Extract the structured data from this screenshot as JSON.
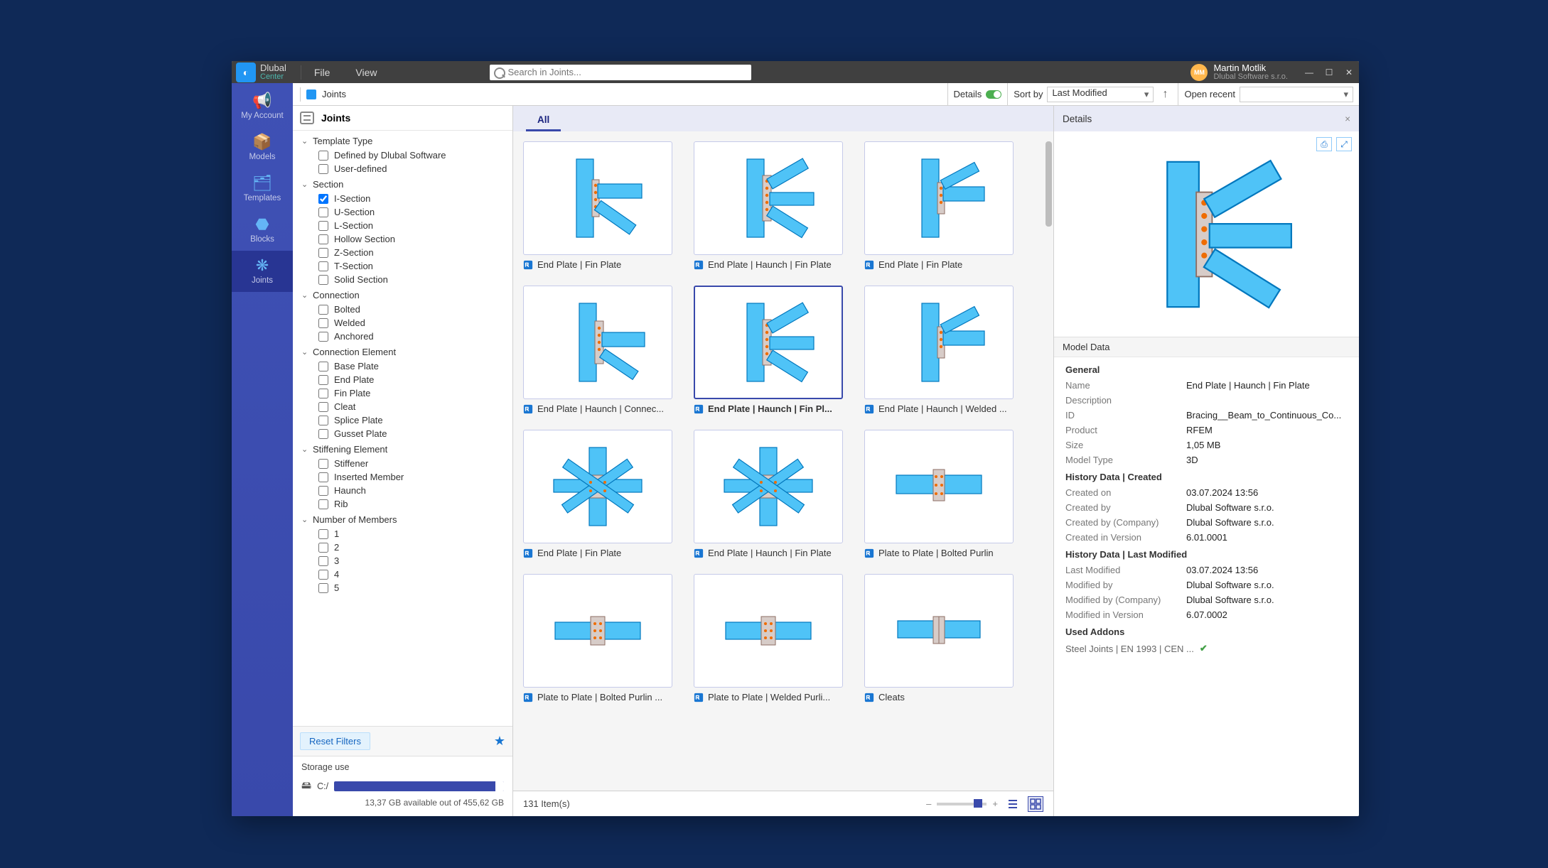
{
  "app": {
    "brand_line1": "Dlubal",
    "brand_line2": "Center"
  },
  "menu": {
    "file": "File",
    "view": "View"
  },
  "search": {
    "placeholder": "Search in Joints..."
  },
  "user": {
    "initials": "MM",
    "name": "Martin Motlik",
    "company": "Dlubal Software s.r.o."
  },
  "navbar": [
    {
      "label": "My Account"
    },
    {
      "label": "Models"
    },
    {
      "label": "Templates"
    },
    {
      "label": "Blocks"
    },
    {
      "label": "Joints"
    }
  ],
  "breadcrumb": {
    "label": "Joints"
  },
  "toolbar": {
    "details_label": "Details",
    "sort_by_label": "Sort by",
    "sort_by_value": "Last Modified",
    "open_recent_label": "Open recent",
    "open_recent_value": ""
  },
  "filter": {
    "title": "Joints",
    "groups": [
      {
        "name": "Template Type",
        "options": [
          {
            "label": "Defined by Dlubal Software",
            "checked": false
          },
          {
            "label": "User-defined",
            "checked": false
          }
        ]
      },
      {
        "name": "Section",
        "options": [
          {
            "label": "I-Section",
            "checked": true
          },
          {
            "label": "U-Section",
            "checked": false
          },
          {
            "label": "L-Section",
            "checked": false
          },
          {
            "label": "Hollow Section",
            "checked": false
          },
          {
            "label": "Z-Section",
            "checked": false
          },
          {
            "label": "T-Section",
            "checked": false
          },
          {
            "label": "Solid Section",
            "checked": false
          }
        ]
      },
      {
        "name": "Connection",
        "options": [
          {
            "label": "Bolted",
            "checked": false
          },
          {
            "label": "Welded",
            "checked": false
          },
          {
            "label": "Anchored",
            "checked": false
          }
        ]
      },
      {
        "name": "Connection Element",
        "options": [
          {
            "label": "Base Plate",
            "checked": false
          },
          {
            "label": "End Plate",
            "checked": false
          },
          {
            "label": "Fin Plate",
            "checked": false
          },
          {
            "label": "Cleat",
            "checked": false
          },
          {
            "label": "Splice Plate",
            "checked": false
          },
          {
            "label": "Gusset Plate",
            "checked": false
          }
        ]
      },
      {
        "name": "Stiffening Element",
        "options": [
          {
            "label": "Stiffener",
            "checked": false
          },
          {
            "label": "Inserted Member",
            "checked": false
          },
          {
            "label": "Haunch",
            "checked": false
          },
          {
            "label": "Rib",
            "checked": false
          }
        ]
      },
      {
        "name": "Number of Members",
        "options": [
          {
            "label": "1",
            "checked": false
          },
          {
            "label": "2",
            "checked": false
          },
          {
            "label": "3",
            "checked": false
          },
          {
            "label": "4",
            "checked": false
          },
          {
            "label": "5",
            "checked": false
          }
        ]
      }
    ],
    "reset_label": "Reset Filters"
  },
  "storage": {
    "title": "Storage use",
    "drive": "C:/",
    "line": "13,37 GB available out of 455,62 GB"
  },
  "tabs": {
    "all": "All"
  },
  "gallery": {
    "items": [
      {
        "title": "End Plate | Fin Plate",
        "shape": "A"
      },
      {
        "title": "End Plate | Haunch | Fin Plate",
        "shape": "B"
      },
      {
        "title": "End Plate | Fin Plate",
        "shape": "C"
      },
      {
        "title": "End Plate | Haunch | Connec...",
        "shape": "D"
      },
      {
        "title": "End Plate | Haunch | Fin Pl...",
        "shape": "B",
        "selected": true
      },
      {
        "title": "End Plate | Haunch | Welded ...",
        "shape": "C"
      },
      {
        "title": "End Plate | Fin Plate",
        "shape": "E"
      },
      {
        "title": "End Plate | Haunch | Fin Plate",
        "shape": "E"
      },
      {
        "title": "Plate to Plate | Bolted Purlin",
        "shape": "F"
      },
      {
        "title": "Plate to Plate | Bolted Purlin ...",
        "shape": "G"
      },
      {
        "title": "Plate to Plate | Welded Purli...",
        "shape": "G"
      },
      {
        "title": "Cleats",
        "shape": "H"
      }
    ],
    "count_label": "131 Item(s)"
  },
  "details": {
    "title": "Details",
    "model_data_label": "Model Data",
    "general_label": "General",
    "general": {
      "Name": "End Plate | Haunch | Fin Plate",
      "Description": "",
      "ID": "Bracing__Beam_to_Continuous_Co...",
      "Product": "RFEM",
      "Size": "1,05 MB",
      "Model Type": "3D"
    },
    "created_label": "History Data | Created",
    "created": {
      "Created on": "03.07.2024 13:56",
      "Created by": "Dlubal Software s.r.o.",
      "Created by (Company)": "Dlubal Software s.r.o.",
      "Created in Version": "6.01.0001"
    },
    "modified_label": "History Data | Last Modified",
    "modified": {
      "Last Modified": "03.07.2024 13:56",
      "Modified by": "Dlubal Software s.r.o.",
      "Modified by (Company)": "Dlubal Software s.r.o.",
      "Modified in Version": "6.07.0002"
    },
    "addons_label": "Used Addons",
    "addon": "Steel Joints | EN 1993 | CEN ..."
  }
}
